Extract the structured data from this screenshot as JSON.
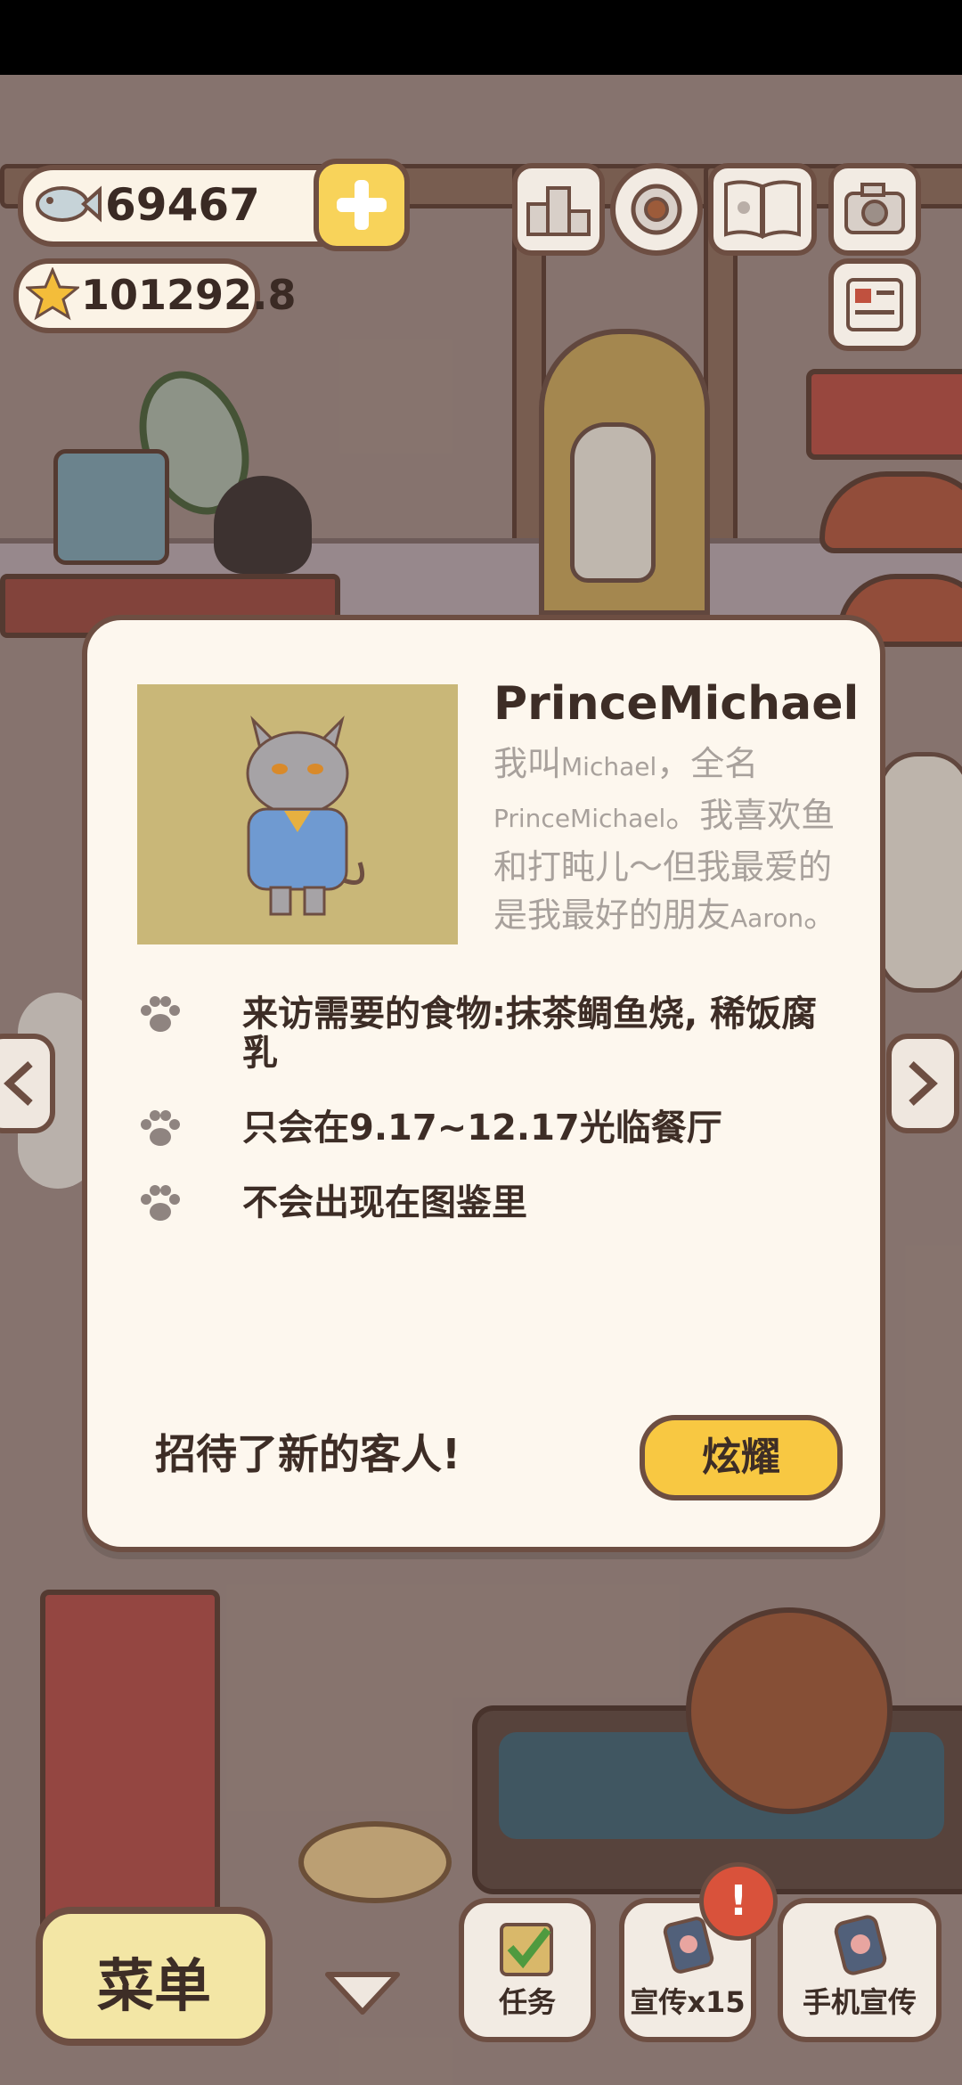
{
  "currency": {
    "fish": "69467",
    "stars": "101292.8"
  },
  "modal": {
    "name": "PrinceMichael",
    "description": {
      "line1_a": "我叫",
      "line1_b": "Michael",
      "line1_c": "，全名",
      "line2_a": "PrinceMichael",
      "line2_b": "。我喜欢鱼",
      "line3": "和打盹儿～但我最爱的",
      "line4_a": "是我最好的朋友",
      "line4_b": "Aaron",
      "line4_c": "。"
    },
    "requirements": [
      "来访需要的食物:抹茶鲷鱼烧, 稀饭腐乳",
      "只会在9.17~12.17光临餐厅",
      "不会出现在图鉴里"
    ],
    "footer": "招待了新的客人!",
    "show_off_label": "炫耀"
  },
  "bottom_bar": {
    "menu_label": "菜单",
    "tasks_label": "任务",
    "promo_label": "宣传x15",
    "phone_promo_label": "手机宣传",
    "promo_badge": "!"
  },
  "icons": {
    "fish": "fish-icon",
    "star": "star-icon",
    "plus": "plus-icon",
    "ranking": "ranking-icon",
    "settings": "gear-icon",
    "catalog": "book-icon",
    "camera": "camera-icon",
    "newspaper": "newspaper-icon",
    "paw": "paw-icon"
  },
  "colors": {
    "accent": "#f8c842",
    "panel": "#fdf7ee",
    "outline": "#6d4e42",
    "badge": "#d9523b"
  }
}
